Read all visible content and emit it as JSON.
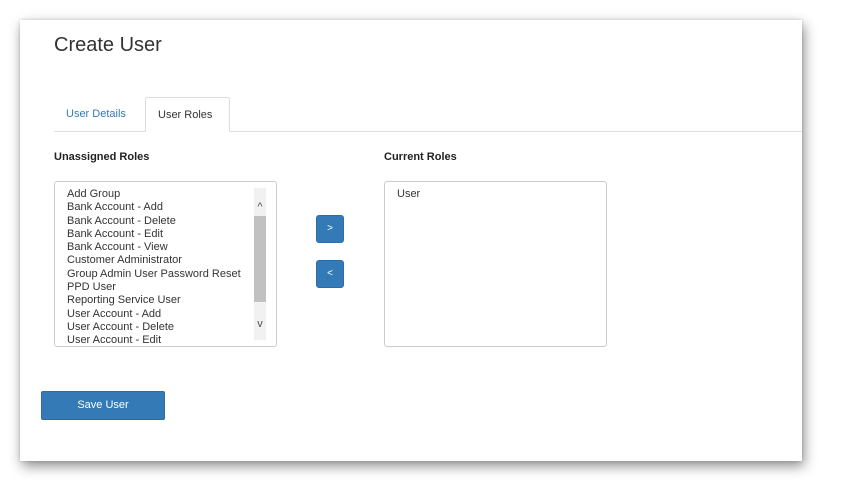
{
  "page": {
    "title": "Create User"
  },
  "tabs": [
    {
      "label": "User Details",
      "active": false
    },
    {
      "label": "User Roles",
      "active": true
    }
  ],
  "unassigned": {
    "label": "Unassigned Roles",
    "items": [
      "Add Group",
      "Bank Account - Add",
      "Bank Account - Delete",
      "Bank Account - Edit",
      "Bank Account - View",
      "Customer Administrator",
      "Group Admin User Password Reset",
      "PPD User",
      "Reporting Service User",
      "User Account - Add",
      "User Account - Delete",
      "User Account - Edit"
    ]
  },
  "current": {
    "label": "Current Roles",
    "items": [
      "User"
    ]
  },
  "controls": {
    "add_label": ">",
    "remove_label": "<",
    "save_label": "Save User",
    "scroll_up_glyph": "^",
    "scroll_down_glyph": "v"
  },
  "colors": {
    "primary": "#337ab7",
    "link": "#337ab7"
  }
}
